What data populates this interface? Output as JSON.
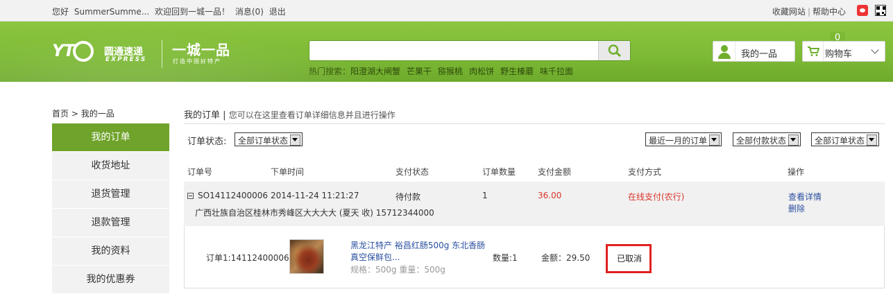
{
  "topbar": {
    "greeting": "您好",
    "username": "SummerSumme...",
    "welcome": "欢迎回到一城一品！",
    "messages": "消息(0)",
    "logout": "退出",
    "favorite": "收藏网站",
    "help": "帮助中心",
    "sep": "|"
  },
  "header": {
    "logo_yto": "YT",
    "logo_cn": "圆通速递",
    "logo_en": "EXPRESS",
    "logo_yicheng": "一城一品",
    "logo_slogan": "打造中国好特产",
    "search_placeholder": "",
    "hot_label": "热门搜索：",
    "hot_keywords": [
      "阳澄湖大闸蟹",
      "芒果干",
      "猕猴桃",
      "肉松饼",
      "野生榛蘑",
      "味千拉面"
    ],
    "my_label": "我的一品",
    "cart_label": "购物车",
    "cart_count": "0"
  },
  "breadcrumb": {
    "home": "首页",
    "arrow": ">",
    "current": "我的一品"
  },
  "sidebar": {
    "items": [
      {
        "label": "我的订单",
        "active": true
      },
      {
        "label": "收货地址"
      },
      {
        "label": "退货管理"
      },
      {
        "label": "退款管理"
      },
      {
        "label": "我的资料"
      },
      {
        "label": "我的优惠券"
      }
    ]
  },
  "main": {
    "title": "我的订单",
    "title_sep": "|",
    "subtitle": "您可以在这里查看订单详细信息并且进行操作",
    "filter_label": "订单状态:",
    "filters": {
      "status": "全部订单状态",
      "period": "最近一月的订单",
      "pay_status": "全部付款状态",
      "order_status": "全部订单状态"
    },
    "columns": [
      "订单号",
      "下单时间",
      "支付状态",
      "订单数量",
      "支付金额",
      "支付方式",
      "操作"
    ],
    "order": {
      "id": "SO14112400006",
      "time": "2014-11-24 11:21:27",
      "pay_status": "待付款",
      "quantity": "1",
      "amount": "36.00",
      "pay_method": "在线支付(农行)",
      "action_view": "查看详情",
      "action_delete": "删除",
      "address": "广西壮族自治区桂林市秀峰区大大大大 (夏天 收) 15712344000"
    },
    "item": {
      "sub_order": "订单1:14112400006",
      "name_line1": "黑龙江特产 裕昌红肠500g 东北香肠",
      "name_line2": "真空保鲜包...",
      "specs": "规格：500g 重量：500g",
      "qty": "数量:1",
      "price": "金额：29.50",
      "status": "已取消"
    }
  },
  "colors": {
    "brand_green": "#7cb934",
    "sidebar_active": "#6fa32b",
    "price_red": "#d9342b",
    "link_blue": "#2a4fa0",
    "highlight_red": "#e02020"
  }
}
